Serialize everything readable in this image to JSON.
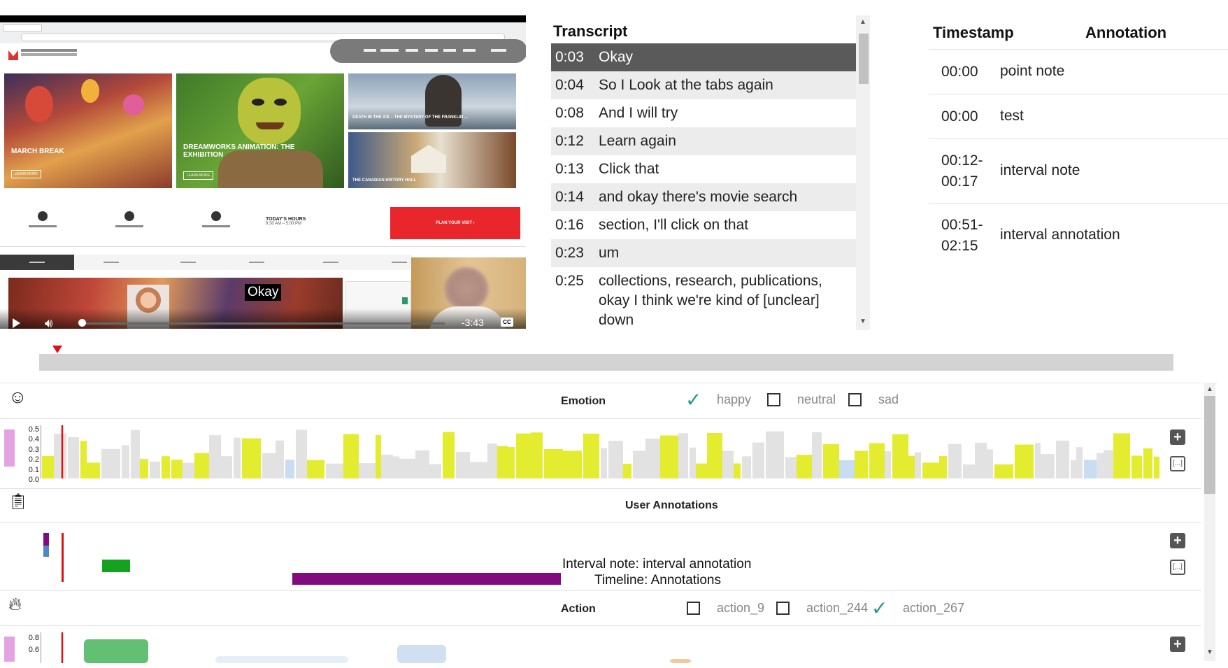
{
  "video": {
    "site": {
      "tile1_title": "MARCH BREAK",
      "tile2_title": "DREAMWORKS ANIMATION: THE EXHIBITION",
      "tile3_title": "DEATH IN THE ICE – THE MYSTERY OF THE FRANKLIN ...",
      "tile4_title": "THE CANADIAN HISTORY HALL",
      "hours_title": "TODAY'S HOURS",
      "hours_value": "9:30 AM – 5:00 PM",
      "plan_button": "PLAN YOUR VISIT ›"
    },
    "subtitle": "Okay",
    "time_remaining": "-3:43",
    "cc_label": "CC"
  },
  "transcript": {
    "title": "Transcript",
    "rows": [
      {
        "time": "0:03",
        "text": "Okay"
      },
      {
        "time": "0:04",
        "text": "So I Look at the tabs again"
      },
      {
        "time": "0:08",
        "text": "And I will try"
      },
      {
        "time": "0:12",
        "text": "Learn again"
      },
      {
        "time": "0:13",
        "text": "Click that"
      },
      {
        "time": "0:14",
        "text": "and okay there's movie search"
      },
      {
        "time": "0:16",
        "text": "section, I'll click on that"
      },
      {
        "time": "0:23",
        "text": "um"
      },
      {
        "time": "0:25",
        "text": "collections, research, publications, okay I think we're kind of [unclear] down"
      }
    ],
    "active_index": 0
  },
  "annotations_table": {
    "header_timestamp": "Timestamp",
    "header_annotation": "Annotation",
    "rows": [
      {
        "time_start": "00:00",
        "time_end": "",
        "text": "point note"
      },
      {
        "time_start": "00:00",
        "time_end": "",
        "text": "test"
      },
      {
        "time_start": "00:12-",
        "time_end": "00:17",
        "text": "interval note"
      },
      {
        "time_start": "00:51-",
        "time_end": "02:15",
        "text": "interval annotation"
      }
    ]
  },
  "tracks": {
    "emotion": {
      "title": "Emotion",
      "icon": "smiley-icon",
      "options": [
        {
          "label": "happy",
          "checked": true
        },
        {
          "label": "neutral",
          "checked": false
        },
        {
          "label": "sad",
          "checked": false
        }
      ],
      "y_ticks": [
        "0.5",
        "0.4",
        "0.3",
        "0.2",
        "0.1",
        "0.0"
      ],
      "colors": {
        "happy": "#e3ec2f",
        "neutral": "#e2e2e2",
        "sad": "#c8dcf2"
      }
    },
    "user_annotations": {
      "title": "User Annotations",
      "icon": "clipboard-icon",
      "hover_line1": "Interval note: interval annotation",
      "hover_line2": "Timeline: Annotations",
      "colors": {
        "interval_note": "#13a31f",
        "interval_annotation": "#7f0d80"
      }
    },
    "action": {
      "title": "Action",
      "icon": "flame-icon",
      "options": [
        {
          "label": "action_9",
          "checked": false
        },
        {
          "label": "action_244",
          "checked": false
        },
        {
          "label": "action_267",
          "checked": true
        }
      ],
      "y_ticks": [
        "0.8",
        "0.6"
      ]
    },
    "plus_symbol": "+",
    "bracket_symbol": "[...]"
  },
  "colors": {
    "playhead": "#e01010",
    "accent_pink": "#e5a2e2",
    "checkmark": "#1e9a8a",
    "plan_red": "#e8262b"
  }
}
